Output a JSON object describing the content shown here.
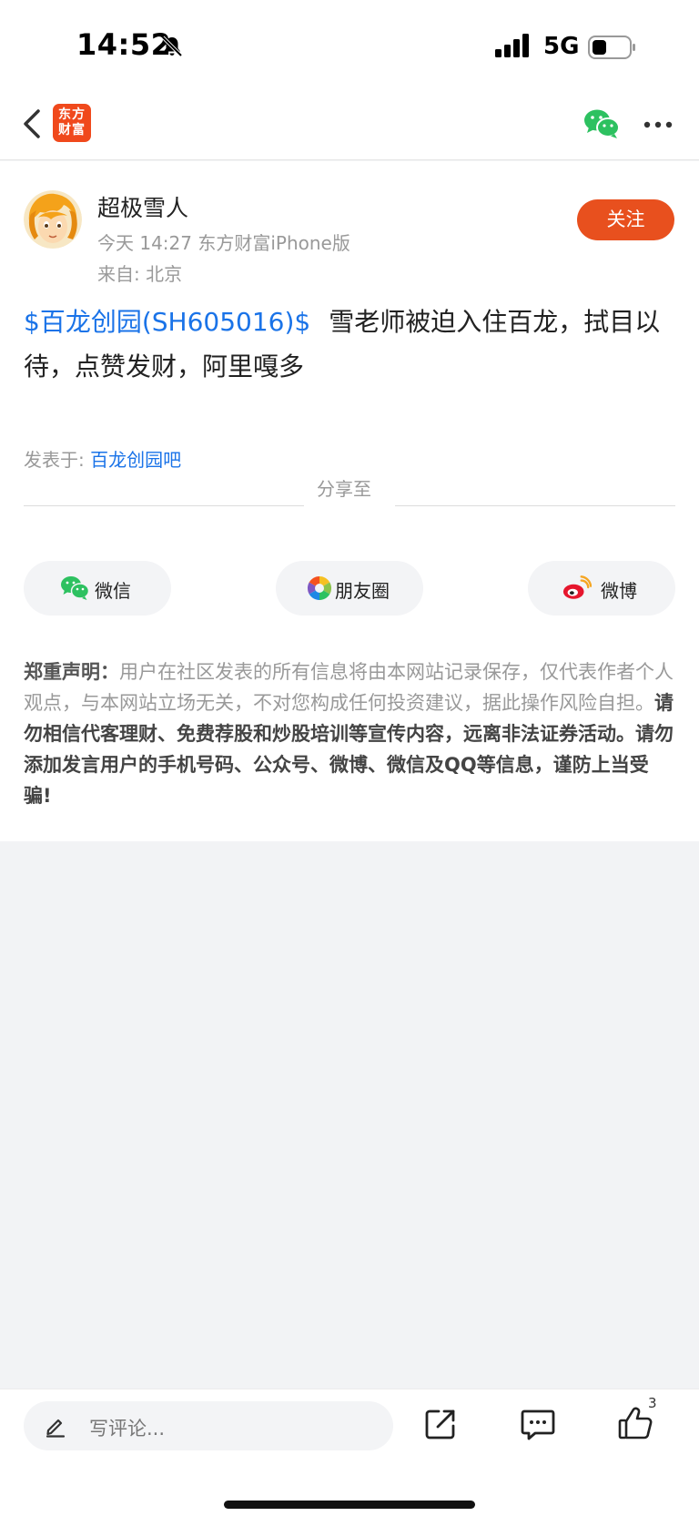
{
  "status_bar": {
    "time": "14:52",
    "network": "5G",
    "icons": [
      "bell-muted-icon",
      "signal-icon",
      "battery-icon"
    ]
  },
  "nav": {
    "logo_text_line1": "东方",
    "logo_text_line2": "财富",
    "icons": [
      "back-icon",
      "wechat-icon",
      "more-icon"
    ],
    "brand_color": "#f0491c"
  },
  "post": {
    "author": "超极雪人",
    "time_source": "今天 14:27 东方财富iPhone版",
    "location": "来自: 北京",
    "follow_label": "关注",
    "stock_tag": "$百龙创园(SH605016)$",
    "body": "雪老师被迫入住百龙，拭目以待，点赞发财，阿里嘎多",
    "posted_in_label": "发表于: ",
    "posted_in_bar": "百龙创园吧"
  },
  "share": {
    "title": "分享至",
    "items": [
      {
        "label": "微信",
        "icon": "wechat-icon"
      },
      {
        "label": "朋友圈",
        "icon": "moments-icon"
      },
      {
        "label": "微博",
        "icon": "weibo-icon"
      }
    ]
  },
  "disclaimer": {
    "heading": "郑重声明：",
    "normal": "用户在社区发表的所有信息将由本网站记录保存，仅代表作者个人观点，与本网站立场无关，不对您构成任何投资建议，据此操作风险自担。",
    "bold": "请勿相信代客理财、免费荐股和炒股培训等宣传内容，远离非法证券活动。请勿添加发言用户的手机号码、公众号、微博、微信及QQ等信息，谨防上当受骗!"
  },
  "bottom_bar": {
    "comment_placeholder": "写评论...",
    "like_count": "3",
    "icons": [
      "pen-icon",
      "share-out-icon",
      "comment-icon",
      "thumbs-up-icon"
    ]
  },
  "colors": {
    "accent_orange": "#e8501e",
    "link_blue": "#1a73e8",
    "muted_text": "#999999"
  }
}
